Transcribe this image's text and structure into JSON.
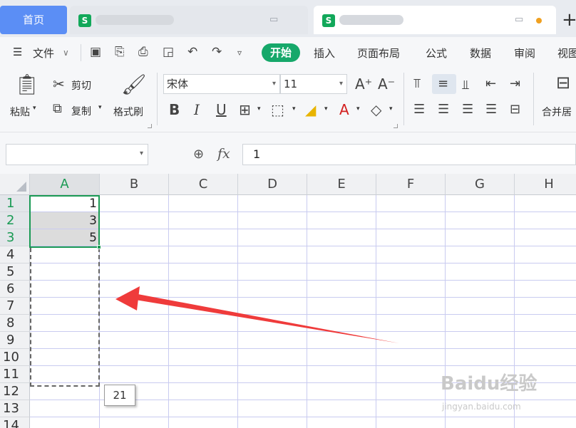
{
  "tabs": {
    "home_label": "首页",
    "file1_icon": "S",
    "file2_icon": "S"
  },
  "menu": {
    "file_label": "文件",
    "active_tab": "开始",
    "items": [
      "插入",
      "页面布局",
      "公式",
      "数据",
      "审阅",
      "视图"
    ]
  },
  "ribbon": {
    "paste_label": "粘贴",
    "cut_label": "剪切",
    "copy_label": "复制",
    "format_painter_label": "格式刷",
    "font_name": "宋体",
    "font_size": "11",
    "merge_label": "合并居"
  },
  "formula": {
    "name_box_value": "",
    "fx_label": "fx",
    "value": "1"
  },
  "sheet": {
    "columns": [
      "A",
      "B",
      "C",
      "D",
      "E",
      "F",
      "G",
      "H"
    ],
    "rows": [
      "1",
      "2",
      "3",
      "4",
      "5",
      "6",
      "7",
      "8",
      "9",
      "10",
      "11",
      "12",
      "13",
      "14"
    ],
    "cells_a": [
      "1",
      "3",
      "5"
    ],
    "fill_tooltip": "21"
  },
  "watermark": {
    "logo": "Baidu经验",
    "url": "jingyan.baidu.com"
  },
  "colors": {
    "accent": "#16a86a",
    "selection": "#1a9a54",
    "home_tab": "#5b8ef5",
    "arrow": "#ef3b3b"
  }
}
